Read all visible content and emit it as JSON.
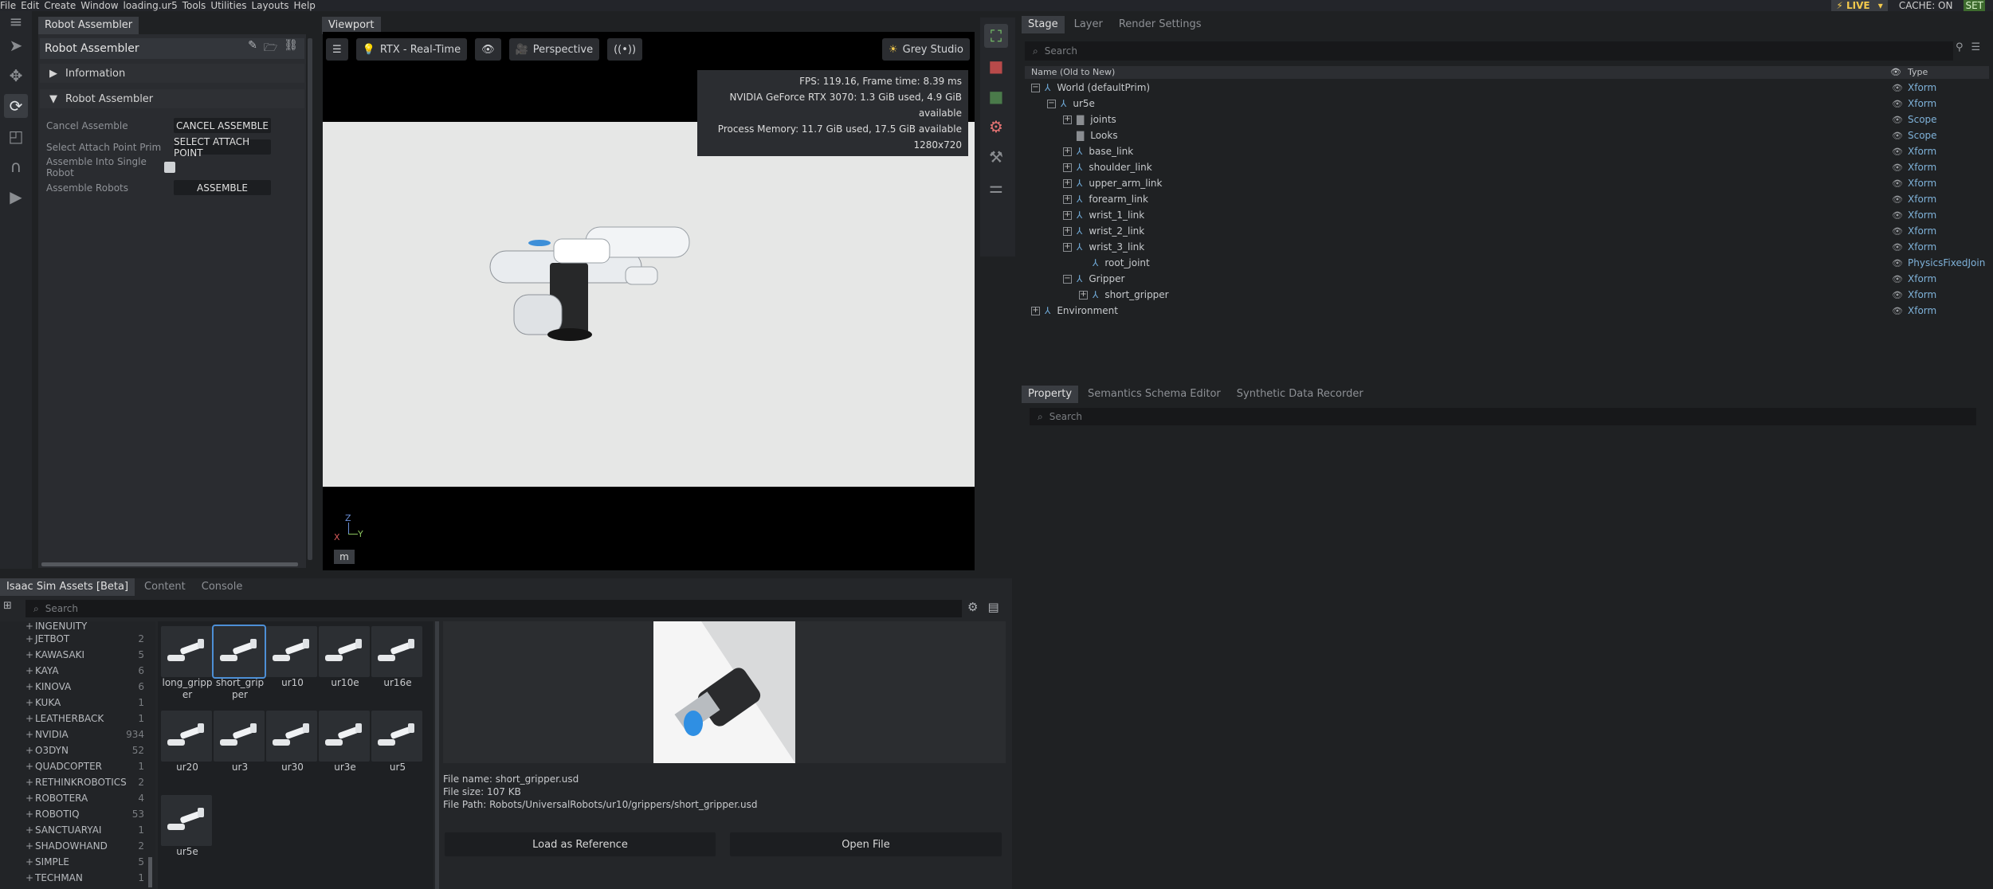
{
  "menu": [
    "File",
    "Edit",
    "Create",
    "Window",
    "loading.ur5",
    "Tools",
    "Utilities",
    "Layouts",
    "Help"
  ],
  "status": {
    "live": "LIVE",
    "cache": "CACHE: ON",
    "set": "SET"
  },
  "robot_assembler": {
    "tab": "Robot Assembler",
    "header": "Robot Assembler",
    "information": "Information",
    "section": "Robot Assembler",
    "rows": [
      {
        "label": "Cancel Assemble",
        "button": "CANCEL ASSEMBLE"
      },
      {
        "label": "Select Attach Point Prim",
        "button": "SELECT ATTACH POINT"
      },
      {
        "label": "Assemble Into Single Robot",
        "button": ""
      },
      {
        "label": "Assemble Robots",
        "button": "ASSEMBLE"
      }
    ]
  },
  "viewport": {
    "tab": "Viewport",
    "render_mode": "RTX - Real-Time",
    "camera": "Perspective",
    "lighting": "Grey Studio",
    "stats": [
      "FPS: 119.16, Frame time: 8.39 ms",
      "NVIDIA GeForce RTX 3070: 1.3 GiB used, 4.9 GiB available",
      "Process Memory: 11.7 GiB used, 17.5 GiB available",
      "1280x720"
    ],
    "axis": {
      "z": "Z",
      "y": "Y",
      "x": "X"
    },
    "unit": "m"
  },
  "stage": {
    "tabs": [
      "Stage",
      "Layer",
      "Render Settings"
    ],
    "search": "Search",
    "col_name": "Name (Old to New)",
    "col_type": "Type",
    "rows": [
      {
        "name": "World (defaultPrim)",
        "type": "Xform",
        "indent": 0,
        "exp": "−"
      },
      {
        "name": "ur5e",
        "type": "Xform",
        "indent": 1,
        "exp": "−"
      },
      {
        "name": "joints",
        "type": "Scope",
        "indent": 2,
        "exp": "+"
      },
      {
        "name": "Looks",
        "type": "Scope",
        "indent": 2,
        "exp": ""
      },
      {
        "name": "base_link",
        "type": "Xform",
        "indent": 2,
        "exp": "+"
      },
      {
        "name": "shoulder_link",
        "type": "Xform",
        "indent": 2,
        "exp": "+"
      },
      {
        "name": "upper_arm_link",
        "type": "Xform",
        "indent": 2,
        "exp": "+"
      },
      {
        "name": "forearm_link",
        "type": "Xform",
        "indent": 2,
        "exp": "+"
      },
      {
        "name": "wrist_1_link",
        "type": "Xform",
        "indent": 2,
        "exp": "+"
      },
      {
        "name": "wrist_2_link",
        "type": "Xform",
        "indent": 2,
        "exp": "+"
      },
      {
        "name": "wrist_3_link",
        "type": "Xform",
        "indent": 2,
        "exp": "+"
      },
      {
        "name": "root_joint",
        "type": "PhysicsFixedJoin",
        "indent": 3,
        "exp": ""
      },
      {
        "name": "Gripper",
        "type": "Xform",
        "indent": 2,
        "exp": "−"
      },
      {
        "name": "short_gripper",
        "type": "Xform",
        "indent": 3,
        "exp": "+"
      },
      {
        "name": "Environment",
        "type": "Xform",
        "indent": 0,
        "exp": "+"
      }
    ]
  },
  "property": {
    "tabs": [
      "Property",
      "Semantics Schema Editor",
      "Synthetic Data Recorder"
    ],
    "search": "Search"
  },
  "assets": {
    "tabs": [
      "Isaac Sim Assets [Beta]",
      "Content",
      "Console"
    ],
    "search": "Search",
    "tree": [
      {
        "name": "INGENUITY",
        "count": ""
      },
      {
        "name": "JETBOT",
        "count": "2"
      },
      {
        "name": "KAWASAKI",
        "count": "5"
      },
      {
        "name": "KAYA",
        "count": "6"
      },
      {
        "name": "KINOVA",
        "count": "6"
      },
      {
        "name": "KUKA",
        "count": "1"
      },
      {
        "name": "LEATHERBACK",
        "count": "1"
      },
      {
        "name": "NVIDIA",
        "count": "934"
      },
      {
        "name": "O3DYN",
        "count": "52"
      },
      {
        "name": "QUADCOPTER",
        "count": "1"
      },
      {
        "name": "RETHINKROBOTICS",
        "count": "2"
      },
      {
        "name": "ROBOTERA",
        "count": "4"
      },
      {
        "name": "ROBOTIQ",
        "count": "53"
      },
      {
        "name": "SANCTUARYAI",
        "count": "1"
      },
      {
        "name": "SHADOWHAND",
        "count": "2"
      },
      {
        "name": "SIMPLE",
        "count": "5"
      },
      {
        "name": "TECHMAN",
        "count": "1"
      }
    ],
    "thumbs": [
      [
        "long_gripp",
        "er"
      ],
      [
        "short_grip",
        "per"
      ],
      [
        "ur10"
      ],
      [
        "ur10e"
      ],
      [
        "ur16e"
      ],
      [
        "ur20"
      ],
      [
        "ur3"
      ],
      [
        "ur30"
      ],
      [
        "ur3e"
      ],
      [
        "ur5"
      ],
      [
        "ur5e"
      ]
    ],
    "file_name": "File name: short_gripper.usd",
    "file_size": "File size: 107 KB",
    "file_path": "File Path: Robots/UniversalRobots/ur10/grippers/short_gripper.usd",
    "load_ref": "Load as Reference",
    "open_file": "Open File"
  }
}
